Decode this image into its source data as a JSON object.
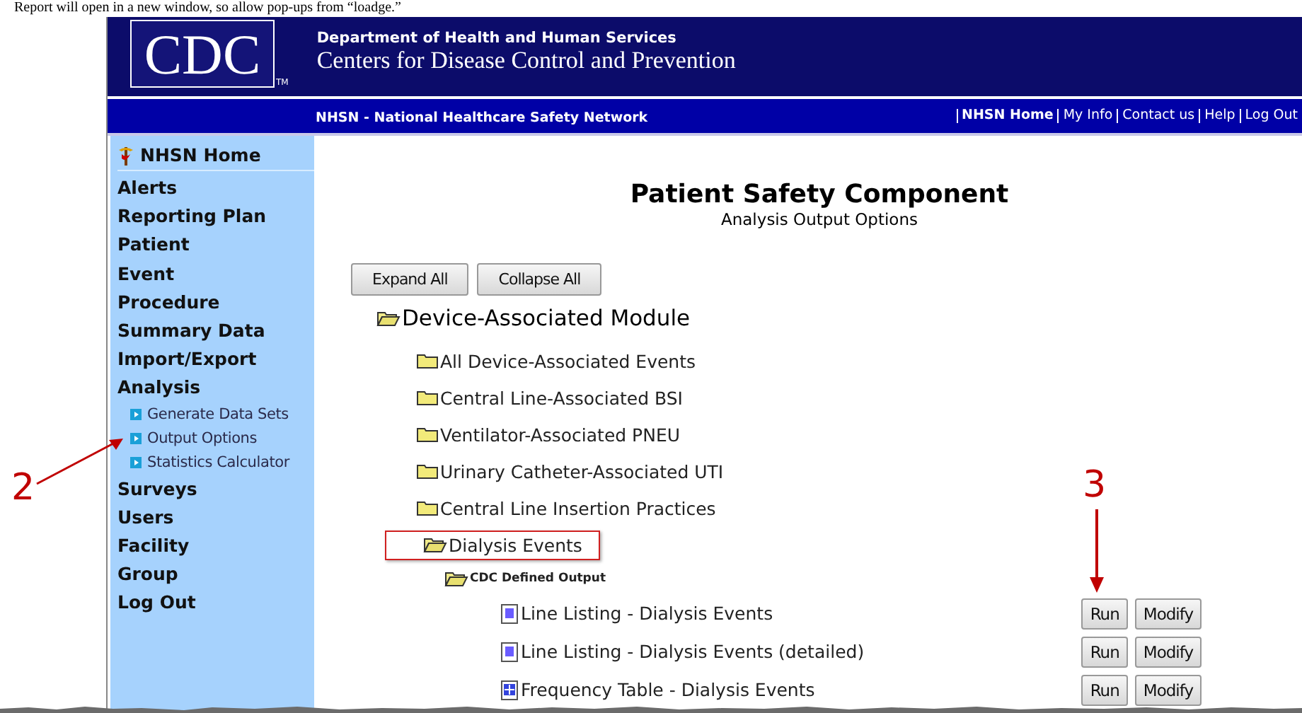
{
  "document_text": "Report will open in a new window, so allow pop-ups from “loadge.”",
  "header": {
    "logo": "CDC",
    "logo_mark": "TM",
    "department": "Department of Health and Human Services",
    "agency": "Centers for Disease Control and Prevention"
  },
  "nav_bar": {
    "title": "NHSN - National Healthcare Safety Network",
    "links": [
      {
        "label": "NHSN Home",
        "bold": true
      },
      {
        "label": "My Info",
        "bold": false
      },
      {
        "label": "Contact us",
        "bold": false
      },
      {
        "label": "Help",
        "bold": false
      },
      {
        "label": "Log Out",
        "bold": false
      }
    ]
  },
  "sidebar": {
    "home": "NHSN Home",
    "items": [
      {
        "label": "Alerts",
        "kind": "section"
      },
      {
        "label": "Reporting Plan",
        "kind": "section"
      },
      {
        "label": "Patient",
        "kind": "section"
      },
      {
        "label": "Event",
        "kind": "section"
      },
      {
        "label": "Procedure",
        "kind": "section"
      },
      {
        "label": "Summary Data",
        "kind": "section"
      },
      {
        "label": "Import/Export",
        "kind": "section"
      },
      {
        "label": "Analysis",
        "kind": "section"
      },
      {
        "label": "Generate Data Sets",
        "kind": "sub"
      },
      {
        "label": "Output Options",
        "kind": "sub"
      },
      {
        "label": "Statistics Calculator",
        "kind": "sub"
      },
      {
        "label": "Surveys",
        "kind": "section"
      },
      {
        "label": "Users",
        "kind": "section"
      },
      {
        "label": "Facility",
        "kind": "section"
      },
      {
        "label": "Group",
        "kind": "section"
      },
      {
        "label": "Log Out",
        "kind": "section"
      }
    ]
  },
  "main": {
    "title": "Patient Safety Component",
    "subtitle": "Analysis Output Options",
    "buttons": [
      "Expand All",
      "Collapse All"
    ],
    "tree": [
      {
        "label": "Device-Associated Module",
        "kind": "module",
        "expanded": true,
        "children": [
          {
            "label": "All Device-Associated Events",
            "kind": "folder",
            "expanded": false
          },
          {
            "label": "Central Line-Associated BSI",
            "kind": "folder",
            "expanded": false
          },
          {
            "label": "Ventilator-Associated PNEU",
            "kind": "folder",
            "expanded": false
          },
          {
            "label": "Urinary Catheter-Associated UTI",
            "kind": "folder",
            "expanded": false
          },
          {
            "label": "Central Line Insertion Practices",
            "kind": "folder",
            "expanded": false
          },
          {
            "label": "Dialysis Events",
            "kind": "folder",
            "expanded": true,
            "boxed": true,
            "children": [
              {
                "label": "CDC Defined Output",
                "kind": "subfolder",
                "expanded": true,
                "children": [
                  {
                    "label": "Line Listing - Dialysis Events",
                    "kind": "listing",
                    "run": "Run",
                    "modify": "Modify"
                  },
                  {
                    "label": "Line Listing - Dialysis Events (detailed)",
                    "kind": "listing",
                    "run": "Run",
                    "modify": "Modify"
                  },
                  {
                    "label": "Frequency Table - Dialysis Events",
                    "kind": "table",
                    "run": "Run",
                    "modify": "Modify"
                  }
                ]
              }
            ]
          }
        ]
      }
    ]
  },
  "annotations": [
    {
      "label": "2",
      "kind": "diagonal"
    },
    {
      "label": "3",
      "kind": "down"
    }
  ]
}
